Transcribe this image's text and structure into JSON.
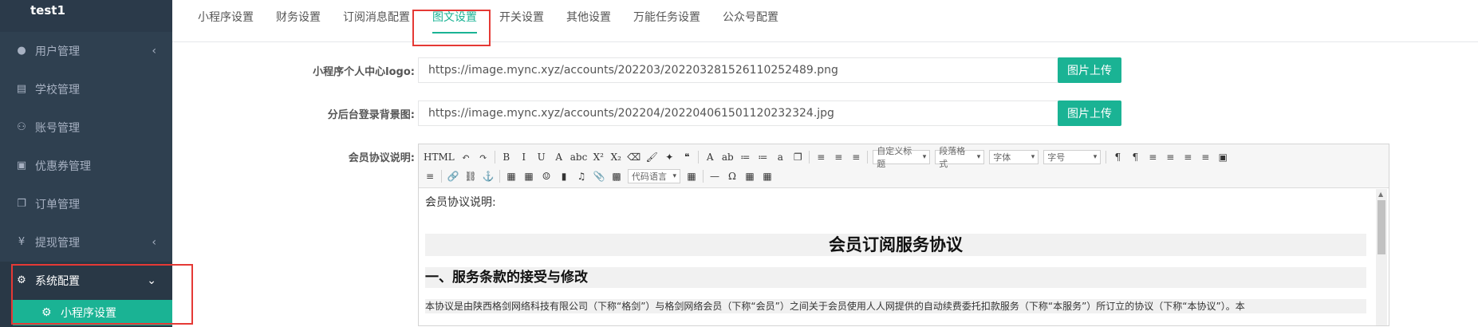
{
  "sidebar": {
    "brand": "test1",
    "items": [
      {
        "label": "用户管理",
        "icon": "user-icon",
        "glyph": "👤",
        "has_arrow": true,
        "arrow": "‹"
      },
      {
        "label": "学校管理",
        "icon": "school-icon",
        "glyph": "▤",
        "has_arrow": false
      },
      {
        "label": "账号管理",
        "icon": "users-icon",
        "glyph": "👥",
        "has_arrow": false
      },
      {
        "label": "优惠券管理",
        "icon": "coupon-icon",
        "glyph": "◙",
        "has_arrow": false
      },
      {
        "label": "订单管理",
        "icon": "order-icon",
        "glyph": "❐",
        "has_arrow": false
      },
      {
        "label": "提现管理",
        "icon": "yen-icon",
        "glyph": "¥",
        "has_arrow": true,
        "arrow": "‹"
      },
      {
        "label": "系统配置",
        "icon": "gear-icon",
        "glyph": "⚙",
        "has_arrow": true,
        "arrow": "⌄",
        "active": true
      }
    ],
    "subitem": {
      "label": "小程序设置",
      "icon": "gear-icon",
      "glyph": "⚙"
    }
  },
  "tabs": [
    {
      "label": "小程序设置"
    },
    {
      "label": "财务设置"
    },
    {
      "label": "订阅消息配置"
    },
    {
      "label": "图文设置",
      "active": true
    },
    {
      "label": "开关设置"
    },
    {
      "label": "其他设置"
    },
    {
      "label": "万能任务设置"
    },
    {
      "label": "公众号配置"
    }
  ],
  "form": {
    "logo_label": "小程序个人中心logo:",
    "logo_value": "https://image.mync.xyz/accounts/202203/20220328152611025248​9.png",
    "bg_label": "分后台登录背景图:",
    "bg_value": "https://image.mync.xyz/accounts/202204/20220406150112023232​4.jpg",
    "upload_label": "图片上传",
    "agreement_label": "会员协议说明:"
  },
  "editor": {
    "row1": [
      "HTML",
      "↶",
      "↷",
      "B",
      "I",
      "U",
      "A",
      "abc",
      "X²",
      "X₂",
      "⌫",
      "🖌",
      "✦",
      "❝",
      "A",
      "ab",
      "≔",
      "≔",
      "a",
      "❐",
      "≡",
      "≡",
      "≡"
    ],
    "row1_selects": [
      "自定义标题",
      "段落格式",
      "字体",
      "字号"
    ],
    "row1_tail": [
      "¶",
      "¶",
      "≡",
      "≡",
      "≡",
      "≡",
      "▣"
    ],
    "row2": [
      "≡",
      "🔗",
      "⛓",
      "⚓",
      "▦",
      "▦",
      "☺",
      "▮",
      "♫",
      "📎",
      "▩"
    ],
    "row2_select": "代码语言",
    "row2_tail": [
      "▦",
      "—",
      "Ω",
      "▦",
      "▦"
    ],
    "content": {
      "intro": "会员协议说明:",
      "title": "会员订阅服务协议",
      "section1": "一、服务条款的接受与修改",
      "paragraph": "本协议是由陕西格剑网络科技有限公司（下称“格剑”）与格剑网络会员（下称“会员”）之间关于会员使用人人网提供的自动续费委托扣款服务（下称“本服务”）所订立的协议（下称“本协议”）。本"
    }
  },
  "colors": {
    "sidebar_bg": "#2f4050",
    "accent": "#1ab394",
    "highlight_border": "#e53935"
  }
}
